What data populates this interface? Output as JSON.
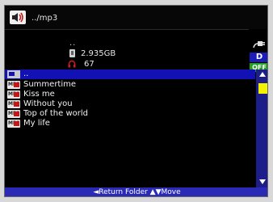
{
  "header": {
    "path": "../mp3",
    "speaker_icon": "speaker-icon"
  },
  "info": {
    "dots": "..",
    "storage_free": "2.935GB",
    "volume": "67",
    "card_icon": "memory-card-icon",
    "headphone_icon": "headphone-icon",
    "plug_icon": "power-plug-icon",
    "drive": "D",
    "off_badge": "OFF"
  },
  "list": {
    "parent_label": "..",
    "items": [
      {
        "label": "Summertime",
        "icon": "mp3-file-icon",
        "icon_text": "MP3"
      },
      {
        "label": "Kiss me",
        "icon": "mp3-file-icon",
        "icon_text": "MP3"
      },
      {
        "label": "Without you",
        "icon": "mp3-file-icon",
        "icon_text": "MP3"
      },
      {
        "label": "Top of the world",
        "icon": "mp3-file-icon",
        "icon_text": "MP3"
      },
      {
        "label": "My life",
        "icon": "mp3-file-icon",
        "icon_text": "MP3"
      }
    ]
  },
  "footer": {
    "hint": "◄Return Folder ▲▼Move"
  },
  "colors": {
    "selection": "#1212b4",
    "footer": "#2a2ab6",
    "scroll_thumb": "#f2f200",
    "drive_badge": "#1c1cb8",
    "off_badge": "#21a221"
  }
}
